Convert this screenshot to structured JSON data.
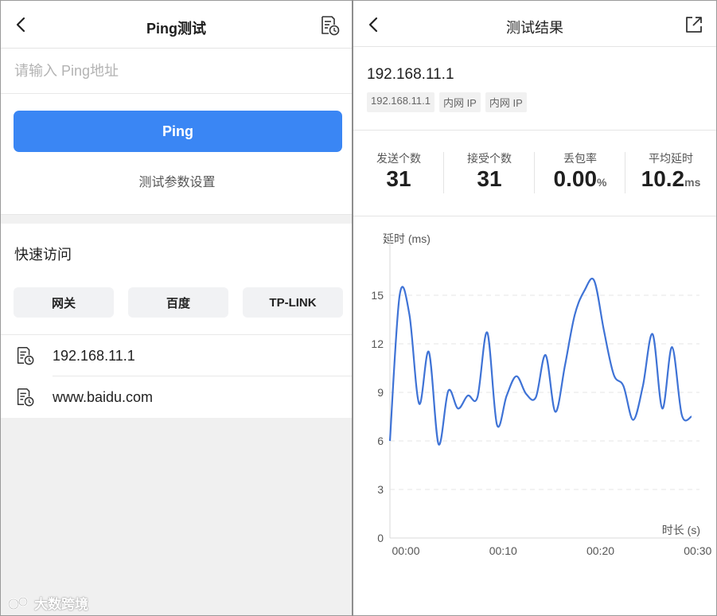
{
  "ping_screen": {
    "title": "Ping测试",
    "input_placeholder": "请输入 Ping地址",
    "ping_button": "Ping",
    "params_link": "测试参数设置",
    "quick_access": {
      "title": "快速访问",
      "buttons": [
        "网关",
        "百度",
        "TP-LINK"
      ]
    },
    "history": [
      "192.168.11.1",
      "www.baidu.com"
    ],
    "watermark": "大数跨境"
  },
  "result_screen": {
    "title": "测试结果",
    "host": "192.168.11.1",
    "tags": [
      "192.168.11.1",
      "内网 IP",
      "内网 IP"
    ],
    "stats": [
      {
        "label": "发送个数",
        "value": "31",
        "unit": ""
      },
      {
        "label": "接受个数",
        "value": "31",
        "unit": ""
      },
      {
        "label": "丢包率",
        "value": "0.00",
        "unit": "%"
      },
      {
        "label": "平均延时",
        "value": "10.2",
        "unit": "ms"
      }
    ]
  },
  "chart_data": {
    "type": "line",
    "ylabel": "延时 (ms)",
    "xlabel": "时长 (s)",
    "ylim": [
      0,
      18
    ],
    "xlim": [
      0,
      31
    ],
    "yticks": [
      0,
      3,
      6,
      9,
      12,
      15
    ],
    "xticks": [
      {
        "value": 0,
        "label": "00:00"
      },
      {
        "value": 10,
        "label": "00:10"
      },
      {
        "value": 20,
        "label": "00:20"
      },
      {
        "value": 30,
        "label": "00:30"
      }
    ],
    "grid": true,
    "color": "#3f73d6",
    "series": [
      {
        "x": [
          0,
          1,
          2,
          3,
          4,
          5,
          6,
          7,
          8,
          9,
          10,
          11,
          12,
          13,
          14,
          15,
          16,
          17,
          18,
          19,
          20,
          21,
          22,
          23,
          24,
          25,
          26,
          27,
          28,
          29,
          30,
          31
        ],
        "values": [
          6.0,
          15.0,
          13.8,
          8.3,
          11.5,
          5.8,
          9.1,
          8.0,
          8.8,
          8.7,
          12.7,
          7.0,
          8.8,
          10.0,
          8.9,
          8.7,
          11.3,
          7.8,
          10.7,
          13.8,
          15.3,
          15.9,
          12.8,
          10.1,
          9.4,
          7.3,
          9.4,
          12.6,
          8.0,
          11.8,
          7.6,
          7.5
        ]
      }
    ]
  }
}
